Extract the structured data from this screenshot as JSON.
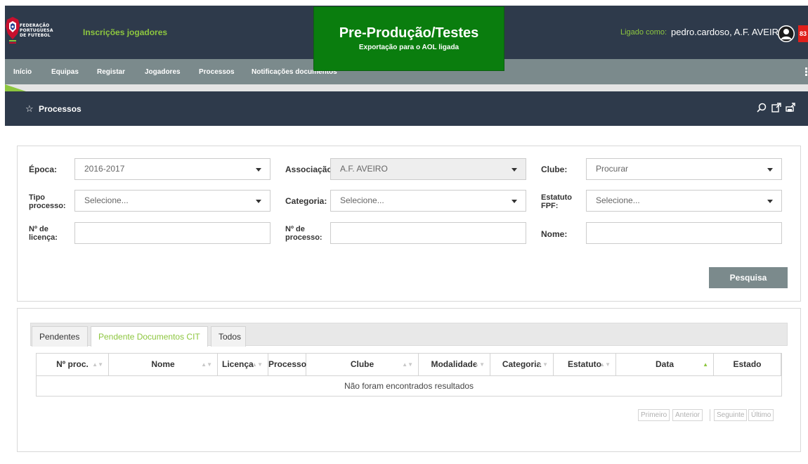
{
  "header": {
    "org_lines": [
      "FEDERAÇÃO",
      "PORTUGUESA",
      "DE FUTEBOL"
    ],
    "app_title": "Inscrições jogadores",
    "environment_title": "Pre-Produção/Testes",
    "environment_subtitle": "Exportação para o AOL ligada",
    "login_label": "Ligado como:",
    "login_user": "pedro.cardoso, A.F. AVEIRO",
    "notification_count": "83"
  },
  "nav": {
    "items": [
      "Início",
      "Equipas",
      "Registar",
      "Jogadores",
      "Processos",
      "Notificações documentos"
    ]
  },
  "page": {
    "title": "Processos"
  },
  "filters": {
    "epoca_label": "Época:",
    "epoca_value": "2016-2017",
    "associacao_label": "Associação:",
    "associacao_value": "A.F. AVEIRO",
    "clube_label": "Clube:",
    "clube_value": "Procurar",
    "tipo_label_1": "Tipo",
    "tipo_label_2": "processo:",
    "tipo_value": "Selecione...",
    "categoria_label": "Categoria:",
    "categoria_value": "Selecione...",
    "estatuto_label_1": "Estatuto",
    "estatuto_label_2": "FPF:",
    "estatuto_value": "Selecione...",
    "licenca_label_1": "Nº de",
    "licenca_label_2": "licença:",
    "processo_label_1": "Nº de",
    "processo_label_2": "processo:",
    "nome_label": "Nome:",
    "search_button": "Pesquisa"
  },
  "tabs": [
    "Pendentes",
    "Pendente Documentos CIT",
    "Todos"
  ],
  "table": {
    "columns": [
      "Nº proc.",
      "Nome",
      "Licença",
      "Processo",
      "Clube",
      "Modalidade",
      "Categoria",
      "Estatuto",
      "Data",
      "Estado"
    ],
    "empty_message": "Não foram encontrados resultados"
  },
  "pagination": {
    "first": "Primeiro",
    "previous": "Anterior",
    "next": "Seguinte",
    "last": "Último"
  },
  "colors": {
    "header_bg": "#2e3a4b",
    "nav_bg": "#7b8a8c",
    "accent_green": "#8dc63f",
    "env_banner": "#0a7d0e",
    "badge_red": "#e0201b"
  }
}
